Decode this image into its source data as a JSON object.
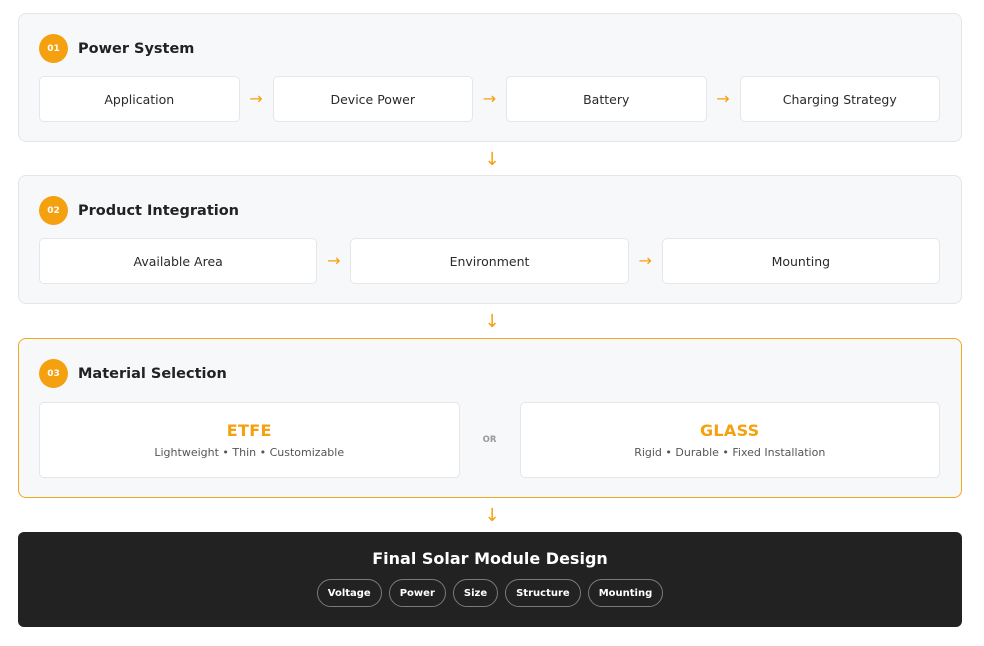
{
  "colors": {
    "accent": "#f5a10f",
    "dark": "#222222",
    "panel": "#f7f8fa"
  },
  "sections": [
    {
      "number": "01",
      "title": "Power System",
      "steps": [
        "Application",
        "Device Power",
        "Battery",
        "Charging Strategy"
      ]
    },
    {
      "number": "02",
      "title": "Product Integration",
      "steps": [
        "Available Area",
        "Environment",
        "Mounting"
      ]
    },
    {
      "number": "03",
      "title": "Material Selection",
      "options": [
        {
          "name": "ETFE",
          "desc": "Lightweight • Thin • Customizable"
        },
        {
          "name": "GLASS",
          "desc": "Rigid • Durable • Fixed Installation"
        }
      ],
      "separator": "OR"
    }
  ],
  "arrows": {
    "right": "→",
    "down": "↓"
  },
  "final": {
    "title": "Final Solar Module Design",
    "tags": [
      "Voltage",
      "Power",
      "Size",
      "Structure",
      "Mounting"
    ]
  }
}
